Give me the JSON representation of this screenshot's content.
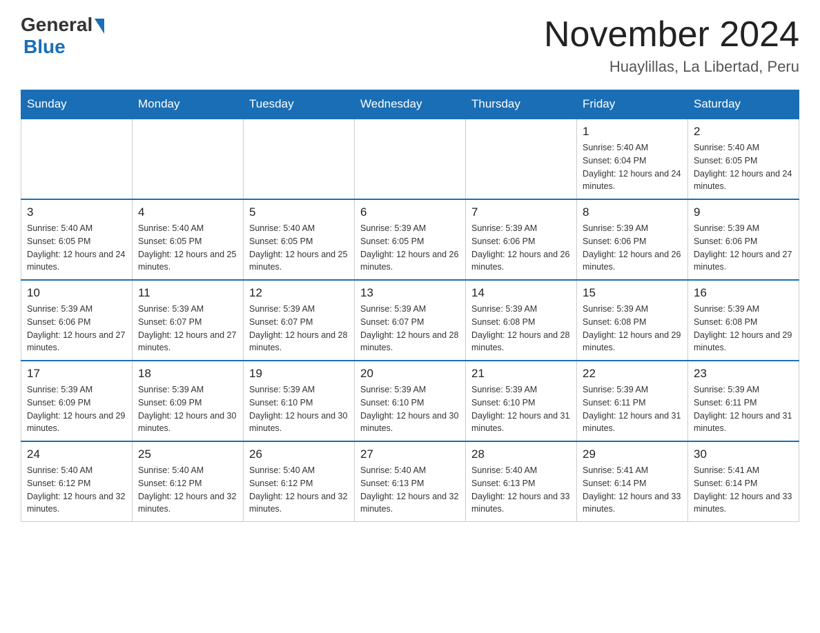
{
  "header": {
    "logo_general": "General",
    "logo_blue": "Blue",
    "month_title": "November 2024",
    "location": "Huaylillas, La Libertad, Peru"
  },
  "weekdays": [
    "Sunday",
    "Monday",
    "Tuesday",
    "Wednesday",
    "Thursday",
    "Friday",
    "Saturday"
  ],
  "weeks": [
    {
      "days": [
        {
          "number": "",
          "sunrise": "",
          "sunset": "",
          "daylight": "",
          "empty": true
        },
        {
          "number": "",
          "sunrise": "",
          "sunset": "",
          "daylight": "",
          "empty": true
        },
        {
          "number": "",
          "sunrise": "",
          "sunset": "",
          "daylight": "",
          "empty": true
        },
        {
          "number": "",
          "sunrise": "",
          "sunset": "",
          "daylight": "",
          "empty": true
        },
        {
          "number": "",
          "sunrise": "",
          "sunset": "",
          "daylight": "",
          "empty": true
        },
        {
          "number": "1",
          "sunrise": "Sunrise: 5:40 AM",
          "sunset": "Sunset: 6:04 PM",
          "daylight": "Daylight: 12 hours and 24 minutes.",
          "empty": false
        },
        {
          "number": "2",
          "sunrise": "Sunrise: 5:40 AM",
          "sunset": "Sunset: 6:05 PM",
          "daylight": "Daylight: 12 hours and 24 minutes.",
          "empty": false
        }
      ]
    },
    {
      "days": [
        {
          "number": "3",
          "sunrise": "Sunrise: 5:40 AM",
          "sunset": "Sunset: 6:05 PM",
          "daylight": "Daylight: 12 hours and 24 minutes.",
          "empty": false
        },
        {
          "number": "4",
          "sunrise": "Sunrise: 5:40 AM",
          "sunset": "Sunset: 6:05 PM",
          "daylight": "Daylight: 12 hours and 25 minutes.",
          "empty": false
        },
        {
          "number": "5",
          "sunrise": "Sunrise: 5:40 AM",
          "sunset": "Sunset: 6:05 PM",
          "daylight": "Daylight: 12 hours and 25 minutes.",
          "empty": false
        },
        {
          "number": "6",
          "sunrise": "Sunrise: 5:39 AM",
          "sunset": "Sunset: 6:05 PM",
          "daylight": "Daylight: 12 hours and 26 minutes.",
          "empty": false
        },
        {
          "number": "7",
          "sunrise": "Sunrise: 5:39 AM",
          "sunset": "Sunset: 6:06 PM",
          "daylight": "Daylight: 12 hours and 26 minutes.",
          "empty": false
        },
        {
          "number": "8",
          "sunrise": "Sunrise: 5:39 AM",
          "sunset": "Sunset: 6:06 PM",
          "daylight": "Daylight: 12 hours and 26 minutes.",
          "empty": false
        },
        {
          "number": "9",
          "sunrise": "Sunrise: 5:39 AM",
          "sunset": "Sunset: 6:06 PM",
          "daylight": "Daylight: 12 hours and 27 minutes.",
          "empty": false
        }
      ]
    },
    {
      "days": [
        {
          "number": "10",
          "sunrise": "Sunrise: 5:39 AM",
          "sunset": "Sunset: 6:06 PM",
          "daylight": "Daylight: 12 hours and 27 minutes.",
          "empty": false
        },
        {
          "number": "11",
          "sunrise": "Sunrise: 5:39 AM",
          "sunset": "Sunset: 6:07 PM",
          "daylight": "Daylight: 12 hours and 27 minutes.",
          "empty": false
        },
        {
          "number": "12",
          "sunrise": "Sunrise: 5:39 AM",
          "sunset": "Sunset: 6:07 PM",
          "daylight": "Daylight: 12 hours and 28 minutes.",
          "empty": false
        },
        {
          "number": "13",
          "sunrise": "Sunrise: 5:39 AM",
          "sunset": "Sunset: 6:07 PM",
          "daylight": "Daylight: 12 hours and 28 minutes.",
          "empty": false
        },
        {
          "number": "14",
          "sunrise": "Sunrise: 5:39 AM",
          "sunset": "Sunset: 6:08 PM",
          "daylight": "Daylight: 12 hours and 28 minutes.",
          "empty": false
        },
        {
          "number": "15",
          "sunrise": "Sunrise: 5:39 AM",
          "sunset": "Sunset: 6:08 PM",
          "daylight": "Daylight: 12 hours and 29 minutes.",
          "empty": false
        },
        {
          "number": "16",
          "sunrise": "Sunrise: 5:39 AM",
          "sunset": "Sunset: 6:08 PM",
          "daylight": "Daylight: 12 hours and 29 minutes.",
          "empty": false
        }
      ]
    },
    {
      "days": [
        {
          "number": "17",
          "sunrise": "Sunrise: 5:39 AM",
          "sunset": "Sunset: 6:09 PM",
          "daylight": "Daylight: 12 hours and 29 minutes.",
          "empty": false
        },
        {
          "number": "18",
          "sunrise": "Sunrise: 5:39 AM",
          "sunset": "Sunset: 6:09 PM",
          "daylight": "Daylight: 12 hours and 30 minutes.",
          "empty": false
        },
        {
          "number": "19",
          "sunrise": "Sunrise: 5:39 AM",
          "sunset": "Sunset: 6:10 PM",
          "daylight": "Daylight: 12 hours and 30 minutes.",
          "empty": false
        },
        {
          "number": "20",
          "sunrise": "Sunrise: 5:39 AM",
          "sunset": "Sunset: 6:10 PM",
          "daylight": "Daylight: 12 hours and 30 minutes.",
          "empty": false
        },
        {
          "number": "21",
          "sunrise": "Sunrise: 5:39 AM",
          "sunset": "Sunset: 6:10 PM",
          "daylight": "Daylight: 12 hours and 31 minutes.",
          "empty": false
        },
        {
          "number": "22",
          "sunrise": "Sunrise: 5:39 AM",
          "sunset": "Sunset: 6:11 PM",
          "daylight": "Daylight: 12 hours and 31 minutes.",
          "empty": false
        },
        {
          "number": "23",
          "sunrise": "Sunrise: 5:39 AM",
          "sunset": "Sunset: 6:11 PM",
          "daylight": "Daylight: 12 hours and 31 minutes.",
          "empty": false
        }
      ]
    },
    {
      "days": [
        {
          "number": "24",
          "sunrise": "Sunrise: 5:40 AM",
          "sunset": "Sunset: 6:12 PM",
          "daylight": "Daylight: 12 hours and 32 minutes.",
          "empty": false
        },
        {
          "number": "25",
          "sunrise": "Sunrise: 5:40 AM",
          "sunset": "Sunset: 6:12 PM",
          "daylight": "Daylight: 12 hours and 32 minutes.",
          "empty": false
        },
        {
          "number": "26",
          "sunrise": "Sunrise: 5:40 AM",
          "sunset": "Sunset: 6:12 PM",
          "daylight": "Daylight: 12 hours and 32 minutes.",
          "empty": false
        },
        {
          "number": "27",
          "sunrise": "Sunrise: 5:40 AM",
          "sunset": "Sunset: 6:13 PM",
          "daylight": "Daylight: 12 hours and 32 minutes.",
          "empty": false
        },
        {
          "number": "28",
          "sunrise": "Sunrise: 5:40 AM",
          "sunset": "Sunset: 6:13 PM",
          "daylight": "Daylight: 12 hours and 33 minutes.",
          "empty": false
        },
        {
          "number": "29",
          "sunrise": "Sunrise: 5:41 AM",
          "sunset": "Sunset: 6:14 PM",
          "daylight": "Daylight: 12 hours and 33 minutes.",
          "empty": false
        },
        {
          "number": "30",
          "sunrise": "Sunrise: 5:41 AM",
          "sunset": "Sunset: 6:14 PM",
          "daylight": "Daylight: 12 hours and 33 minutes.",
          "empty": false
        }
      ]
    }
  ]
}
